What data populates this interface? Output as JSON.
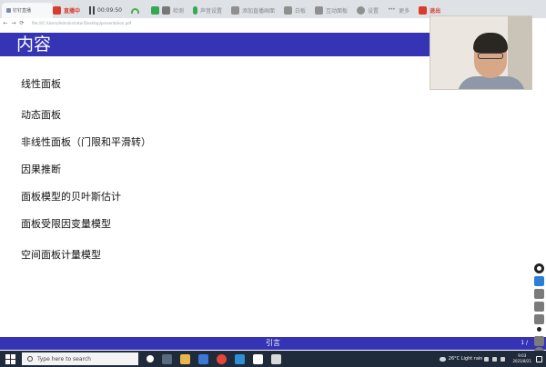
{
  "browser": {
    "tab_title": "钉钉直播",
    "url": "file:///C:/Users/Administrator/Desktop/presentation.pdf",
    "nav_back": "←",
    "nav_forward": "→",
    "nav_reload": "⟳"
  },
  "meeting_toolbar": {
    "status": "直播中",
    "timer": "00:09:50",
    "items": [
      "检测",
      "声音设置",
      "添加直播画面",
      "白板",
      "互动面板",
      "设置",
      "更多"
    ],
    "exit": "退出"
  },
  "slide": {
    "title": "内容",
    "outline": [
      "线性面板",
      "动态面板",
      "非线性面板（门限和平滑转）",
      "因果推断",
      "面板模型的贝叶斯估计",
      "面板受限因变量模型",
      "空间面板计量模型"
    ],
    "footer_label": "引言",
    "page": "1 /"
  },
  "taskbar": {
    "search_placeholder": "Type here to search",
    "weather": "26°C  Light rain",
    "time": "9:03",
    "date": "2021/8/21"
  },
  "colors": {
    "slide_blue": "#3434b4",
    "taskbar": "#1f2a3a",
    "live_red": "#d83c2a"
  }
}
